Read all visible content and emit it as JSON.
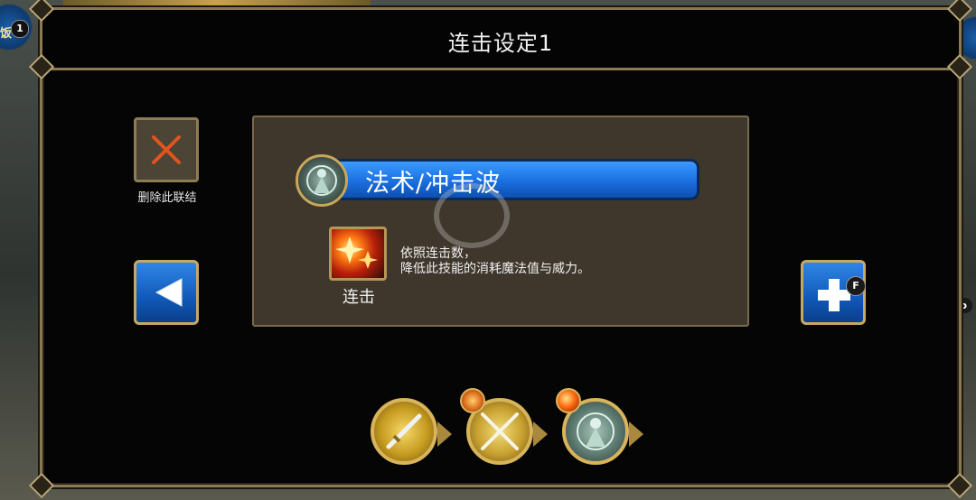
{
  "hud": {
    "left_badge": "1",
    "left_glyph": "饭",
    "tab_key": "Tab"
  },
  "dialog": {
    "title": "连击设定1",
    "delete_label": "删除此联结",
    "add_key_hint": "F"
  },
  "skill": {
    "name": "法术/冲击波",
    "combo_label": "连击",
    "combo_description": "依照连击数，\n降低此技能的消耗魔法值与威力。"
  },
  "chain": {
    "slots": [
      "sword-skill-icon",
      "crossed-swords-icon",
      "mage-orb-icon"
    ],
    "badges": [
      "fist-icon",
      "combo-burst-icon"
    ]
  },
  "colors": {
    "frame_gold": "#8a7a54",
    "skill_bar_blue": "#1b6fe0",
    "delete_red": "#e0541e"
  }
}
